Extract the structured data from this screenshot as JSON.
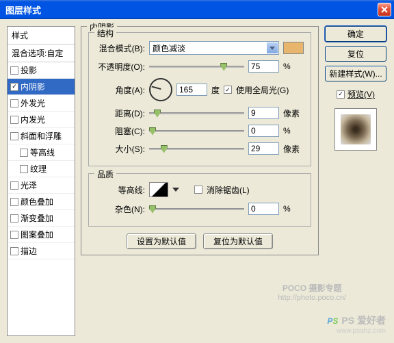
{
  "titlebar": {
    "title": "图层样式"
  },
  "styleList": {
    "header": "样式",
    "subheader": "混合选项:自定",
    "items": [
      {
        "label": "投影",
        "checked": false,
        "selected": false,
        "indent": false
      },
      {
        "label": "内阴影",
        "checked": true,
        "selected": true,
        "indent": false
      },
      {
        "label": "外发光",
        "checked": false,
        "selected": false,
        "indent": false
      },
      {
        "label": "内发光",
        "checked": false,
        "selected": false,
        "indent": false
      },
      {
        "label": "斜面和浮雕",
        "checked": false,
        "selected": false,
        "indent": false
      },
      {
        "label": "等高线",
        "checked": false,
        "selected": false,
        "indent": true
      },
      {
        "label": "纹理",
        "checked": false,
        "selected": false,
        "indent": true
      },
      {
        "label": "光泽",
        "checked": false,
        "selected": false,
        "indent": false
      },
      {
        "label": "颜色叠加",
        "checked": false,
        "selected": false,
        "indent": false
      },
      {
        "label": "渐变叠加",
        "checked": false,
        "selected": false,
        "indent": false
      },
      {
        "label": "图案叠加",
        "checked": false,
        "selected": false,
        "indent": false
      },
      {
        "label": "描边",
        "checked": false,
        "selected": false,
        "indent": false
      }
    ]
  },
  "mainPanel": {
    "title": "内阴影",
    "structure": {
      "legend": "结构",
      "blendModeLabel": "混合模式(B):",
      "blendModeValue": "颜色减淡",
      "colorSwatch": "#E8B56D",
      "opacityLabel": "不透明度(O):",
      "opacityValue": "75",
      "opacityUnit": "%",
      "opacityThumb": 75,
      "angleLabel": "角度(A):",
      "angleValue": "165",
      "angleUnit": "度",
      "globalLight": "使用全局光(G)",
      "globalLightChecked": true,
      "distanceLabel": "距离(D):",
      "distanceValue": "9",
      "distanceUnit": "像素",
      "distanceThumb": 5,
      "chokeLabel": "阻塞(C):",
      "chokeValue": "0",
      "chokeUnit": "%",
      "chokeThumb": 0,
      "sizeLabel": "大小(S):",
      "sizeValue": "29",
      "sizeUnit": "像素",
      "sizeThumb": 12
    },
    "quality": {
      "legend": "品质",
      "contourLabel": "等高线:",
      "antialiasLabel": "消除锯齿(L)",
      "antialiasChecked": false,
      "noiseLabel": "杂色(N):",
      "noiseValue": "0",
      "noiseUnit": "%",
      "noiseThumb": 0
    },
    "buttons": {
      "setDefault": "设置为默认值",
      "resetDefault": "复位为默认值"
    }
  },
  "rightPanel": {
    "ok": "确定",
    "cancel": "复位",
    "newStyle": "新建样式(W)...",
    "preview": "预览(V)",
    "previewChecked": true
  },
  "watermark": {
    "line1": "POCO 摄影专题",
    "line2": "http://photo.poco.cn/",
    "ps": "PS 爱好者",
    "url": "www.psahz.com"
  }
}
